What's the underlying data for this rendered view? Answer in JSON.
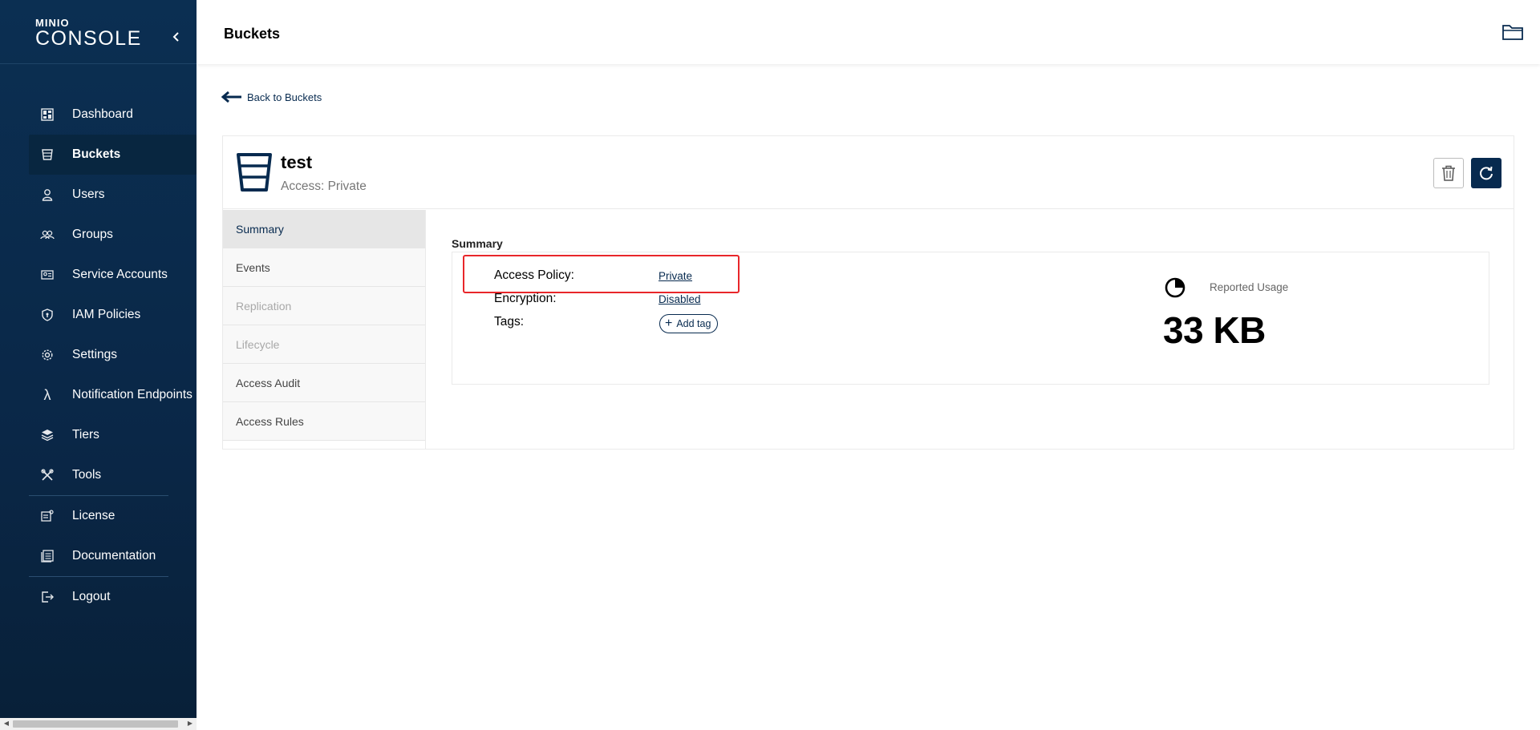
{
  "logo": {
    "brand": "MINIO",
    "product": "CONSOLE"
  },
  "sidebar": {
    "items": [
      {
        "label": "Dashboard",
        "icon": "dashboard-icon"
      },
      {
        "label": "Buckets",
        "icon": "bucket-icon"
      },
      {
        "label": "Users",
        "icon": "user-icon"
      },
      {
        "label": "Groups",
        "icon": "groups-icon"
      },
      {
        "label": "Service Accounts",
        "icon": "service-accounts-icon"
      },
      {
        "label": "IAM Policies",
        "icon": "shield-icon"
      },
      {
        "label": "Settings",
        "icon": "gear-icon"
      },
      {
        "label": "Notification Endpoints",
        "icon": "lambda-icon"
      },
      {
        "label": "Tiers",
        "icon": "layers-icon"
      },
      {
        "label": "Tools",
        "icon": "tools-icon"
      },
      {
        "label": "License",
        "icon": "license-icon"
      },
      {
        "label": "Documentation",
        "icon": "documentation-icon"
      },
      {
        "label": "Logout",
        "icon": "logout-icon"
      }
    ],
    "active": "Buckets"
  },
  "header": {
    "title": "Buckets"
  },
  "back_link": "Back to Buckets",
  "bucket": {
    "name": "test",
    "access": "Access: Private"
  },
  "tabs": [
    {
      "label": "Summary",
      "state": "active"
    },
    {
      "label": "Events",
      "state": "normal"
    },
    {
      "label": "Replication",
      "state": "disabled"
    },
    {
      "label": "Lifecycle",
      "state": "disabled"
    },
    {
      "label": "Access Audit",
      "state": "normal"
    },
    {
      "label": "Access Rules",
      "state": "normal"
    }
  ],
  "summary": {
    "title": "Summary",
    "access_policy_label": "Access Policy:",
    "access_policy_value": "Private",
    "encryption_label": "Encryption:",
    "encryption_value": "Disabled",
    "tags_label": "Tags:",
    "add_tag_label": "Add tag",
    "usage_label": "Reported Usage",
    "usage_value": "33 KB"
  },
  "colors": {
    "sidebar_bg": "#0b2f52",
    "accent": "#072a4f",
    "highlight": "#e8262a"
  }
}
